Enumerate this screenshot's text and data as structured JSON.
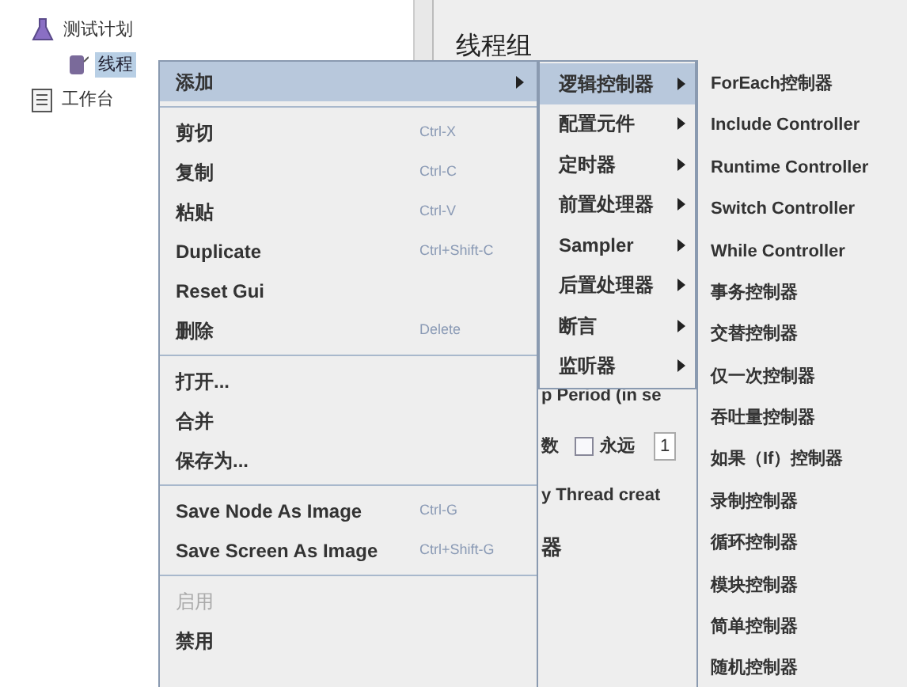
{
  "tree": [
    {
      "kind": "plan",
      "label": "测试计划",
      "selected": false,
      "children": [
        {
          "kind": "thread",
          "label": "线程",
          "selected": true
        }
      ]
    },
    {
      "kind": "workbench",
      "label": "工作台",
      "selected": false
    }
  ],
  "panel": {
    "title": "线程组",
    "ramp_label": "p Period (in se",
    "loop_label": "数",
    "forever": {
      "label": "永远",
      "checked": false
    },
    "loop_value": "1",
    "delay_label": "y Thread creat",
    "sampler_label": "器"
  },
  "menu": [
    {
      "kind": "item",
      "label": "添加",
      "selected": true,
      "disabled": false,
      "submenu": true
    },
    {
      "kind": "separator"
    },
    {
      "kind": "item",
      "label": "剪切",
      "shortcut": "Ctrl-X",
      "selected": false,
      "disabled": false,
      "submenu": false
    },
    {
      "kind": "item",
      "label": "复制",
      "shortcut": "Ctrl-C",
      "selected": false,
      "disabled": false,
      "submenu": false
    },
    {
      "kind": "item",
      "label": "粘贴",
      "shortcut": "Ctrl-V",
      "selected": false,
      "disabled": false,
      "submenu": false
    },
    {
      "kind": "item",
      "label": "Duplicate",
      "shortcut": "Ctrl+Shift-C",
      "selected": false,
      "disabled": false,
      "submenu": false
    },
    {
      "kind": "item",
      "label": "Reset Gui",
      "selected": false,
      "disabled": false,
      "submenu": false
    },
    {
      "kind": "item",
      "label": "删除",
      "shortcut": "Delete",
      "selected": false,
      "disabled": false,
      "submenu": false
    },
    {
      "kind": "separator"
    },
    {
      "kind": "item",
      "label": "打开...",
      "selected": false,
      "disabled": false,
      "submenu": false
    },
    {
      "kind": "item",
      "label": "合并",
      "selected": false,
      "disabled": false,
      "submenu": false
    },
    {
      "kind": "item",
      "label": "保存为...",
      "selected": false,
      "disabled": false,
      "submenu": false
    },
    {
      "kind": "separator"
    },
    {
      "kind": "item",
      "label": "Save Node As Image",
      "shortcut": "Ctrl-G",
      "selected": false,
      "disabled": false,
      "submenu": false
    },
    {
      "kind": "item",
      "label": "Save Screen As Image",
      "shortcut": "Ctrl+Shift-G",
      "selected": false,
      "disabled": false,
      "submenu": false
    },
    {
      "kind": "separator"
    },
    {
      "kind": "item",
      "label": "启用",
      "selected": false,
      "disabled": true,
      "submenu": false
    },
    {
      "kind": "item",
      "label": "禁用",
      "selected": false,
      "disabled": false,
      "submenu": false
    }
  ],
  "submenu": [
    {
      "label": "逻辑控制器",
      "selected": true
    },
    {
      "label": "配置元件",
      "selected": false
    },
    {
      "label": "定时器",
      "selected": false
    },
    {
      "label": "前置处理器",
      "selected": false
    },
    {
      "label": "Sampler",
      "selected": false
    },
    {
      "label": "后置处理器",
      "selected": false
    },
    {
      "label": "断言",
      "selected": false
    },
    {
      "label": "监听器",
      "selected": false
    }
  ],
  "controllers": [
    {
      "label": "ForEach控制器",
      "selected": false
    },
    {
      "label": "Include Controller",
      "selected": false
    },
    {
      "label": "Runtime Controller",
      "selected": false
    },
    {
      "label": "Switch Controller",
      "selected": false
    },
    {
      "label": "While Controller",
      "selected": false
    },
    {
      "label": "事务控制器",
      "selected": false
    },
    {
      "label": "交替控制器",
      "selected": false
    },
    {
      "label": "仅一次控制器",
      "selected": false
    },
    {
      "label": "吞吐量控制器",
      "selected": false
    },
    {
      "label": "如果（If）控制器",
      "selected": false
    },
    {
      "label": "录制控制器",
      "selected": false
    },
    {
      "label": "循环控制器",
      "selected": false
    },
    {
      "label": "模块控制器",
      "selected": false
    },
    {
      "label": "简单控制器",
      "selected": false
    },
    {
      "label": "随机控制器",
      "selected": false
    }
  ]
}
